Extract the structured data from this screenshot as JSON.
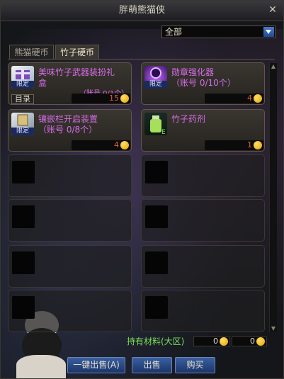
{
  "window": {
    "title": "胖萌熊猫侠"
  },
  "filter": {
    "selected": "全部"
  },
  "tabs": [
    {
      "label": "熊猫硬币",
      "active": false
    },
    {
      "label": "竹子硬币",
      "active": true
    }
  ],
  "items": [
    {
      "name_line1": "美味竹子武器装扮礼",
      "name_line2": "盒",
      "limit": "（账号 0/1个）",
      "badge": "限定",
      "price": "15",
      "has_catalog": true,
      "catalog_label": "目录"
    },
    {
      "name_line1": "勋章强化器",
      "name_line2": "",
      "limit": "（账号 0/10个）",
      "badge": "限定",
      "price": "4",
      "has_catalog": false
    },
    {
      "name_line1": "镶嵌栏开启装置",
      "name_line2": "",
      "limit": "（账号 0/8个）",
      "badge": "限定",
      "price": "4",
      "has_catalog": false
    },
    {
      "name_line1": "竹子药剂",
      "name_line2": "",
      "limit": "",
      "badge": "",
      "price": "1",
      "has_catalog": false
    }
  ],
  "materials": {
    "label": "持有材料(大区)",
    "values": [
      "0",
      "0"
    ]
  },
  "buttons": {
    "sell_all": "一键出售(A)",
    "sell": "出售",
    "buy": "购买"
  },
  "icons": {
    "close": "close-icon",
    "coin": "coin-icon",
    "dropdown": "chevron-down-icon"
  },
  "colors": {
    "item_name": "#d66ce8",
    "price": "#e05a3a",
    "material_label": "#7dde5a",
    "button": "#2b4c8a"
  }
}
